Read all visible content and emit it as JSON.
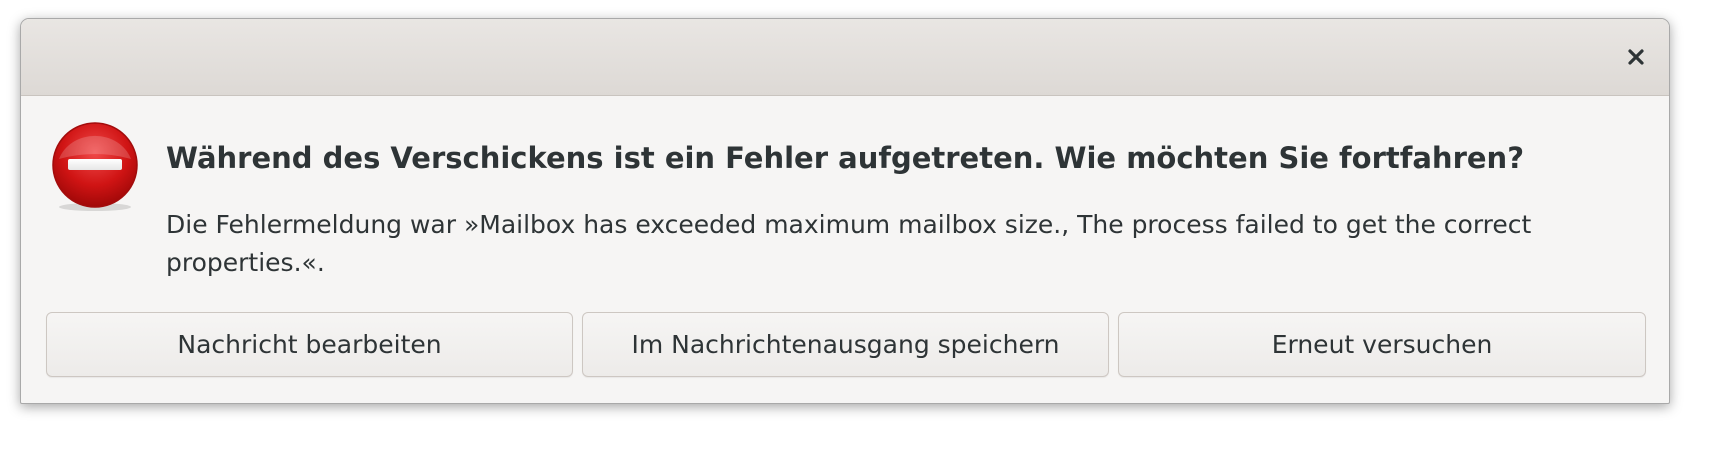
{
  "dialog": {
    "close_icon": "close-icon",
    "status_icon": "error-icon",
    "heading": "Während des Verschickens ist ein Fehler aufgetreten. Wie möchten Sie fortfahren?",
    "message": "Die Fehlermeldung war »Mailbox has exceeded maximum mailbox size., The process failed to get the correct properties.«.",
    "buttons": {
      "edit_label": "Nachricht bearbeiten",
      "outbox_label": "Im Nachrichtenausgang speichern",
      "retry_label": "Erneut versuchen"
    },
    "colors": {
      "error_red": "#cc0000",
      "text": "#2e3436",
      "background": "#f6f5f4",
      "titlebar": "#e3dfdb"
    }
  }
}
